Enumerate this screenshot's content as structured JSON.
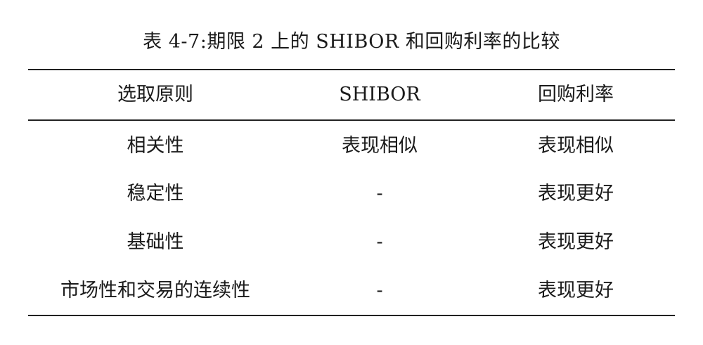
{
  "caption": "表 4-7:期限 2 上的 SHIBOR 和回购利率的比较",
  "table": {
    "headers": [
      "选取原则",
      "SHIBOR",
      "回购利率"
    ],
    "rows": [
      [
        "相关性",
        "表现相似",
        "表现相似"
      ],
      [
        "稳定性",
        "-",
        "表现更好"
      ],
      [
        "基础性",
        "-",
        "表现更好"
      ],
      [
        "市场性和交易的连续性",
        "-",
        "表现更好"
      ]
    ]
  }
}
